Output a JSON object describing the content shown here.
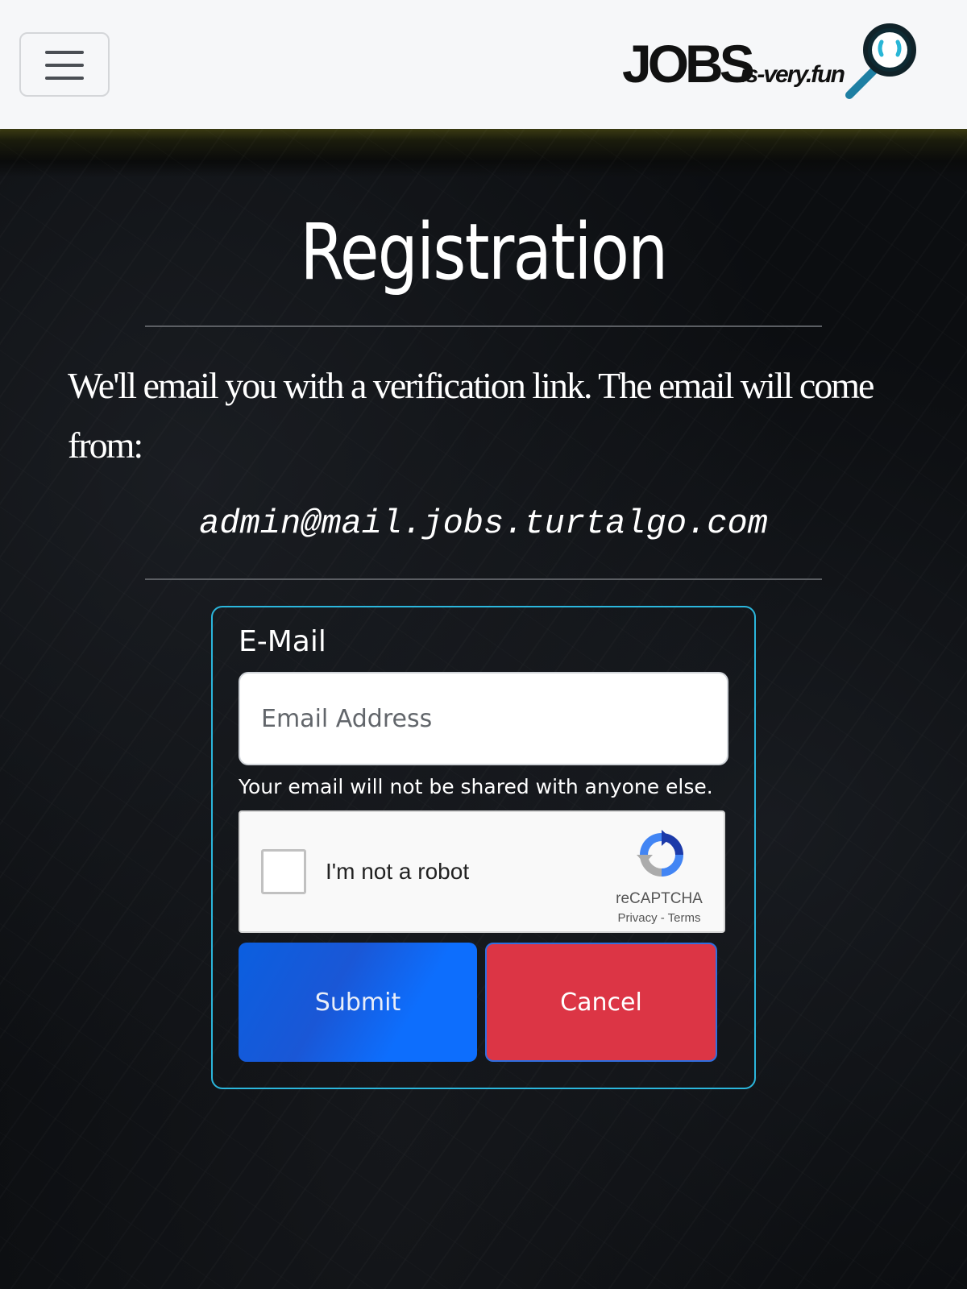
{
  "navbar": {
    "menu_button": "Toggle navigation",
    "brand": {
      "word": "JOBS",
      "suffix": ".is-very.fun"
    }
  },
  "main": {
    "title": "Registration",
    "intro": "We'll email you with a verification link. The email will come from:",
    "sender_email": "admin@mail.jobs.turtalgo.com"
  },
  "form": {
    "email_label": "E-Mail",
    "email_placeholder": "Email Address",
    "email_value": "",
    "help_text": "Your email will not be shared with anyone else.",
    "captcha": {
      "label": "I'm not a robot",
      "brand": "reCAPTCHA",
      "links": "Privacy - Terms"
    },
    "submit_label": "Submit",
    "cancel_label": "Cancel"
  },
  "colors": {
    "accent_border": "#2bb6dc",
    "submit": "#0d6efd",
    "cancel": "#dc3545"
  }
}
